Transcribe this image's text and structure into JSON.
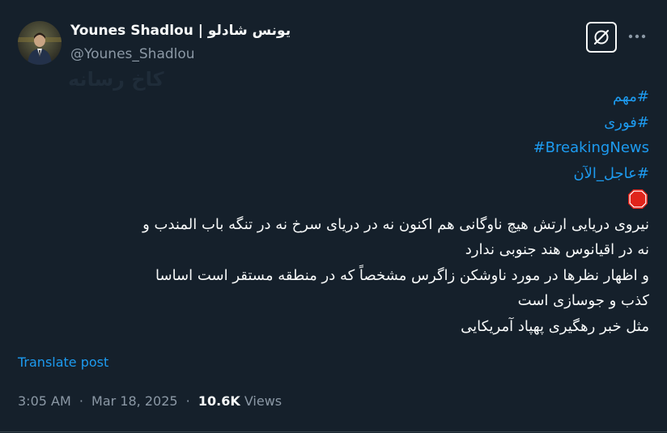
{
  "author": {
    "display_name": "Younes Shadlou | یونس شادلو",
    "handle": "@Younes_Shadlou"
  },
  "watermark": "کاخ رسانه",
  "icons": {
    "grok": "grok-slash-icon",
    "more": "more-dots-icon",
    "stop": "stop-sign-icon"
  },
  "post": {
    "hashtags": [
      "#مهم",
      "#فوری",
      "#BreakingNews",
      "#عاجل_الآن"
    ],
    "lines": [
      "نیروی دریایی ارتش هیچ ناوگانی هم اکنون نه در دریای سرخ نه در تنگه باب المندب و",
      "نه در اقیانوس هند جنوبی ندارد",
      "و اظهار نظرها در مورد ناوشکن زاگرس مشخصاً که در منطقه مستقر است اساسا",
      "کذب و جوسازی است",
      "مثل خبر رهگیری پهپاد آمریکایی"
    ]
  },
  "translate_label": "Translate post",
  "meta": {
    "time": "3:05 AM",
    "separator": "·",
    "date": "Mar 18, 2025",
    "views_count": "10.6K",
    "views_label": "Views"
  },
  "colors": {
    "background": "#15202b",
    "text": "#f7f9f9",
    "secondary": "#8b98a5",
    "accent": "#1d9bf0",
    "stop_red": "#e0241b"
  }
}
